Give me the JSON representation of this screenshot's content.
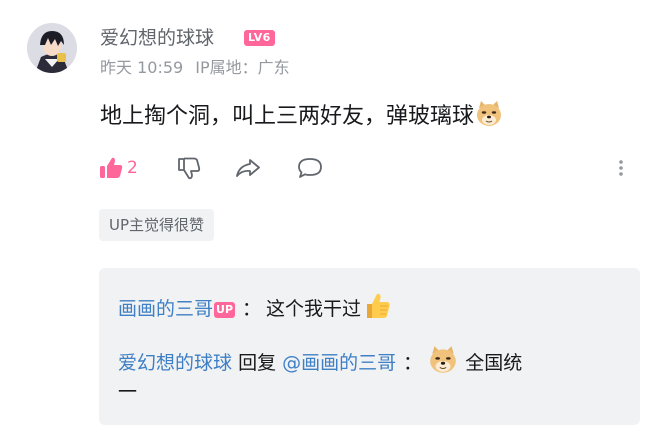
{
  "comment": {
    "username": "爱幻想的球球",
    "level_badge": "LV6",
    "time": "昨天 10:59",
    "ip_location": "IP属地：广东",
    "content_text": "地上掏个洞，叫上三两好友，弹玻璃球",
    "content_emoji": "doge-emoji",
    "like_count": "2",
    "up_liked_label": "UP主觉得很赞"
  },
  "replies": [
    {
      "user": "画画的三哥",
      "is_up": true,
      "up_badge": "UP",
      "separator": "：",
      "text": "这个我干过",
      "emoji": "thumbs-up-emoji"
    },
    {
      "user": "爱幻想的球球",
      "reply_word": "回复",
      "reply_to": "@画画的三哥",
      "separator": "：",
      "emoji": "doge-emoji",
      "text_line1": "全国统",
      "text_line2": "一"
    }
  ],
  "icons": {
    "like": "thumbs-up-icon",
    "dislike": "thumbs-down-icon",
    "share": "share-icon",
    "reply": "comment-bubble-icon",
    "more": "more-vertical-icon"
  },
  "colors": {
    "accent_pink": "#ff6699",
    "link_blue": "#3e7fc6",
    "muted_gray": "#9499a0",
    "reply_bg": "#f1f2f3"
  }
}
